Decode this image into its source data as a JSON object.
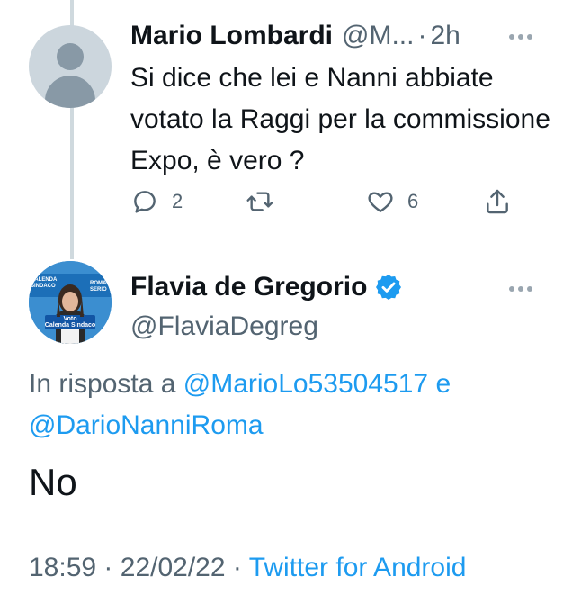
{
  "reply": {
    "name": "Mario Lombardi",
    "handle": "@M...",
    "separator": "·",
    "time": "2h",
    "text": "Si dice che lei e Nanni abbiate votato la Raggi per la commissione Expo, è vero ?",
    "actions": {
      "replies": "2",
      "retweets": "",
      "likes": "6"
    }
  },
  "main": {
    "name": "Flavia de Gregorio",
    "handle": "@FlaviaDegreg",
    "avatar_banner": {
      "left": "CALENDA SINDACO",
      "right": "ROMA SERIO",
      "bottom_line1": "Voto",
      "bottom_line2": "Calenda Sindaco"
    },
    "in_reply_to_label": "In risposta a",
    "mention_1": "@MarioLo53504517",
    "conjunction": "e",
    "mention_2": "@DarioNanniRoma",
    "text": "No",
    "time": "18:59",
    "date": "22/02/22",
    "meta_separator": "·",
    "source": "Twitter for Android"
  },
  "colors": {
    "link": "#1d9bf0",
    "secondary_text": "#536471",
    "thread_line": "#cfd9de",
    "verified": "#1d9bf0"
  }
}
